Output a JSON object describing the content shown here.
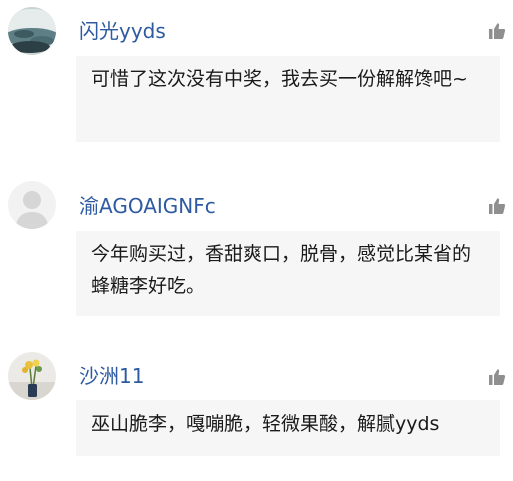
{
  "comments": [
    {
      "username": "闪光yyds",
      "text": "可惜了这次没有中奖，我去买一份解解馋吧~",
      "avatar_icon": "scenic-avatar-icon",
      "like_icon": "thumbs-up-icon"
    },
    {
      "username": "渝AGOAIGNFc",
      "text": "今年购买过，香甜爽口，脱骨，感觉比某省的蜂糖李好吃。",
      "avatar_icon": "default-person-avatar-icon",
      "like_icon": "thumbs-up-icon"
    },
    {
      "username": "沙洲11",
      "text": "巫山脆李，嘎嘣脆，轻微果酸，解腻yyds",
      "avatar_icon": "flower-vase-avatar-icon",
      "like_icon": "thumbs-up-icon"
    }
  ],
  "colors": {
    "username": "#2d5aa0",
    "bubble_bg": "#f6f6f6",
    "text": "#1a1a1a",
    "like_icon": "#8f8f8f"
  }
}
